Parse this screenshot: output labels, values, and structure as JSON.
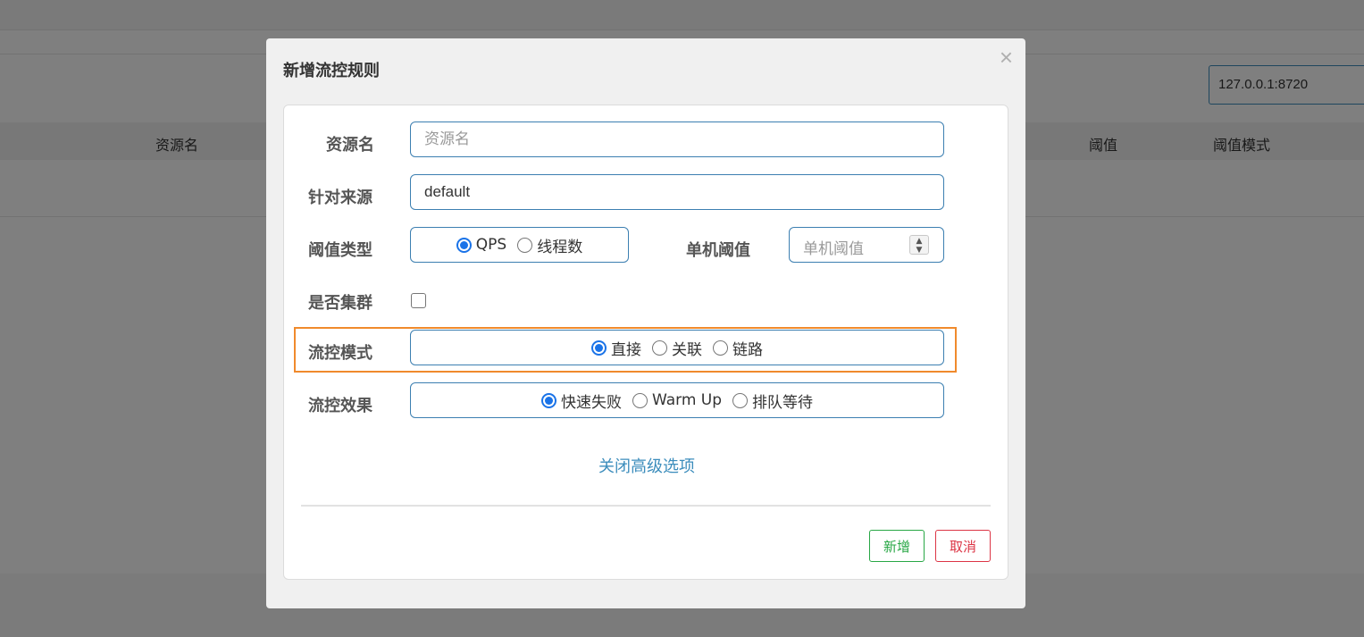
{
  "background": {
    "ip_value": "127.0.0.1:8720",
    "table_headers": {
      "resource": "资源名",
      "threshold": "阈值",
      "threshold_mode": "阈值模式"
    }
  },
  "modal": {
    "title": "新增流控规则",
    "close_glyph": "×",
    "fields": {
      "resource": {
        "label": "资源名",
        "placeholder": "资源名",
        "value": ""
      },
      "source": {
        "label": "针对来源",
        "value": "default"
      },
      "threshold_type": {
        "label": "阈值类型",
        "options": [
          "QPS",
          "线程数"
        ],
        "selected": "QPS"
      },
      "single_threshold": {
        "label": "单机阈值",
        "placeholder": "单机阈值"
      },
      "cluster": {
        "label": "是否集群",
        "checked": false
      },
      "flow_mode": {
        "label": "流控模式",
        "options": [
          "直接",
          "关联",
          "链路"
        ],
        "selected": "直接"
      },
      "flow_effect": {
        "label": "流控效果",
        "options": [
          "快速失败",
          "Warm Up",
          "排队等待"
        ],
        "selected": "快速失败"
      }
    },
    "advanced_link": "关闭高级选项",
    "buttons": {
      "add": "新增",
      "cancel": "取消"
    }
  },
  "colors": {
    "primary": "#3c7fb1",
    "radio": "#1a73e8",
    "highlight": "#f08a2c",
    "add": "#28a745",
    "cancel": "#dc3545",
    "link": "#3c8dbc"
  }
}
